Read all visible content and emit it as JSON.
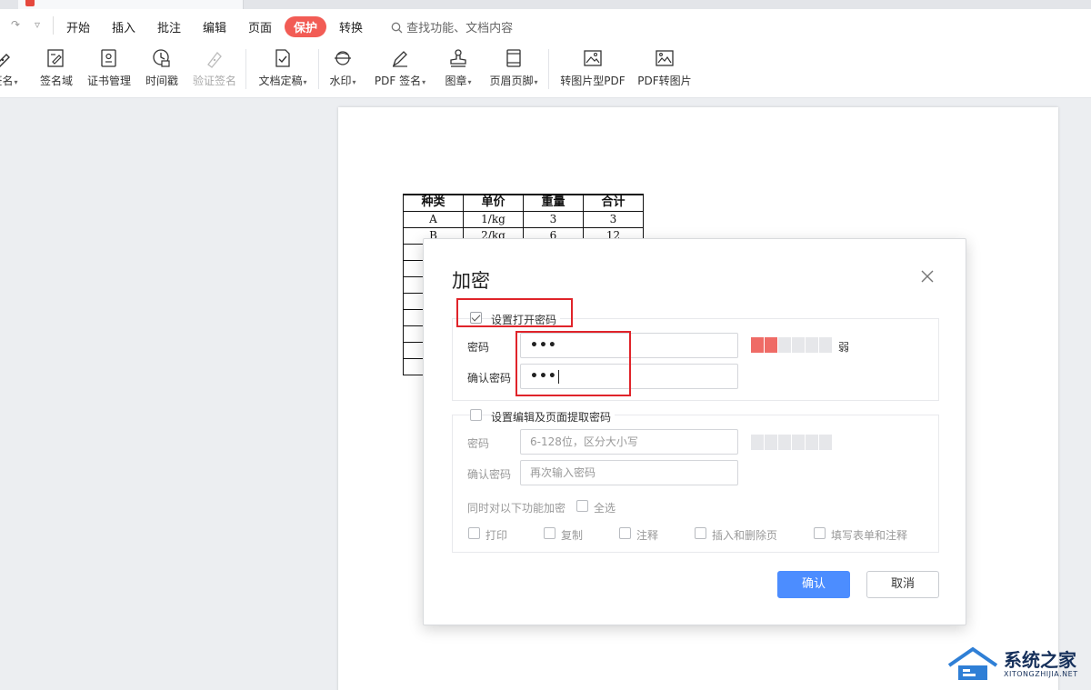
{
  "menubar": {
    "items": [
      "开始",
      "插入",
      "批注",
      "编辑",
      "页面",
      "保护",
      "转换"
    ],
    "active": "保护",
    "search_placeholder": "查找功能、文档内容"
  },
  "ribbon": {
    "buttons": [
      {
        "label": "签名",
        "icon": "signature-icon",
        "dropdown": true
      },
      {
        "label": "签名域",
        "icon": "signature-field-icon"
      },
      {
        "label": "证书管理",
        "icon": "certificate-icon"
      },
      {
        "label": "时间戳",
        "icon": "timestamp-icon"
      },
      {
        "label": "验证签名",
        "icon": "verify-signature-icon",
        "disabled": true
      },
      {
        "label": "文档定稿",
        "icon": "finalize-document-icon",
        "dropdown": true
      },
      {
        "label": "水印",
        "icon": "watermark-icon",
        "dropdown": true
      },
      {
        "label": "PDF 签名",
        "icon": "pdf-sign-icon",
        "dropdown": true
      },
      {
        "label": "图章",
        "icon": "stamp-icon",
        "dropdown": true
      },
      {
        "label": "页眉页脚",
        "icon": "header-footer-icon",
        "dropdown": true
      },
      {
        "label": "转图片型PDF",
        "icon": "image-pdf-icon"
      },
      {
        "label": "PDF转图片",
        "icon": "pdf-to-image-icon"
      }
    ]
  },
  "document": {
    "table": {
      "headers": [
        "种类",
        "单价",
        "重量",
        "合计"
      ],
      "rows": [
        [
          "A",
          "1/kg",
          "3",
          "3"
        ],
        [
          "B",
          "2/kg",
          "6",
          "12"
        ]
      ]
    }
  },
  "dialog": {
    "title": "加密",
    "open_password": {
      "checkbox_label": "设置打开密码",
      "checked": true,
      "password_label": "密码",
      "password_value": "•••",
      "confirm_label": "确认密码",
      "confirm_value": "•••",
      "strength_label": "弱"
    },
    "edit_password": {
      "checkbox_label": "设置编辑及页面提取密码",
      "checked": false,
      "password_label": "密码",
      "password_placeholder": "6-128位，区分大小写",
      "confirm_label": "确认密码",
      "confirm_placeholder": "再次输入密码",
      "encrypt_label": "同时对以下功能加密",
      "select_all_label": "全选",
      "options": [
        "打印",
        "复制",
        "注释",
        "插入和删除页",
        "填写表单和注释"
      ]
    },
    "confirm_button": "确认",
    "cancel_button": "取消"
  },
  "watermark": {
    "title": "系统之家",
    "subtitle": "XITONGZHIJIA.NET"
  },
  "colors": {
    "protect_tab": "#f25c55",
    "primary_button": "#4c8dff",
    "strength_weak": "#ef6b66",
    "annotation_red": "#e0242a"
  }
}
